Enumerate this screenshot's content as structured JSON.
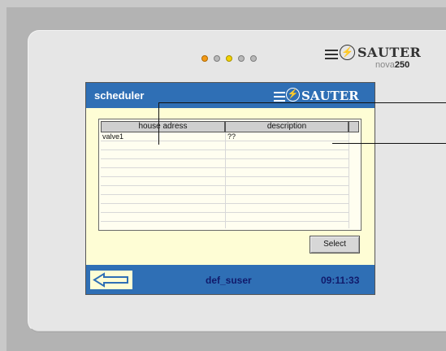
{
  "brand": {
    "name": "SAUTER",
    "model_prefix": "nova",
    "model_number": "250"
  },
  "leds": [
    "orange",
    "grey",
    "yellow",
    "grey",
    "grey"
  ],
  "screen": {
    "title": "scheduler",
    "logo_text": "SAUTER",
    "table": {
      "headers": [
        "house adress",
        "description"
      ],
      "rows": [
        {
          "address": "valve1",
          "description": "??"
        }
      ]
    },
    "select_label": "Select",
    "user": "def_suser",
    "time": "09:11:33"
  },
  "icons": {
    "back": "back-arrow-icon",
    "logo": "sauter-logo-icon"
  },
  "colors": {
    "bar": "#2f6fb5",
    "panel": "#fefdd5",
    "status_text": "#111a6b",
    "led_orange": "#f39a16",
    "led_yellow": "#f2d100"
  }
}
